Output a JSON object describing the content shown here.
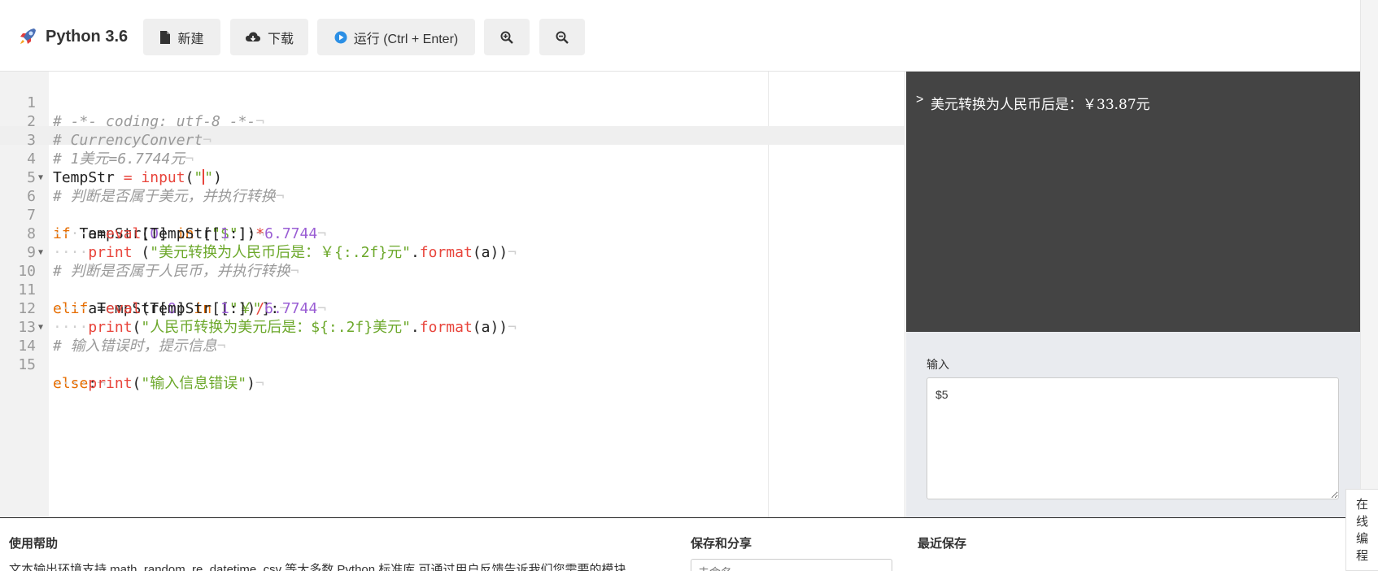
{
  "toolbar": {
    "title": "Python 3.6",
    "new_label": "新建",
    "download_label": "下载",
    "run_label": "运行 (Ctrl + Enter)"
  },
  "editor": {
    "lines": [
      {
        "n": "1",
        "code": "# -*- coding: utf-8 -*-"
      },
      {
        "n": "2",
        "code": "# CurrencyConvert"
      },
      {
        "n": "3",
        "code": "# 1美元=6.7744元"
      },
      {
        "n": "4",
        "code": "TempStr = input(\"\")"
      },
      {
        "n": "5",
        "code": "# 判断是否属于美元，并执行转换"
      },
      {
        "n": "6",
        "code": "if TempStr[0] in [\"$\"]:"
      },
      {
        "n": "7",
        "code": "    a=eval(TempStr[1:])*6.7744"
      },
      {
        "n": "8",
        "code": "    print (\"美元转换为人民币后是：￥{:.2f}元\".format(a))"
      },
      {
        "n": "9",
        "code": "# 判断是否属于人民币，并执行转换"
      },
      {
        "n": "10",
        "code": "elif TempStr[0] in [\"￥\"]:"
      },
      {
        "n": "11",
        "code": "    a=eval(TempStr[1:])/6.7744"
      },
      {
        "n": "12",
        "code": "    print(\"人民币转换为美元后是：${:.2f}美元\".format(a))"
      },
      {
        "n": "13",
        "code": "# 输入错误时，提示信息"
      },
      {
        "n": "14",
        "code": "else:"
      },
      {
        "n": "15",
        "code": "    print(\"输入信息错误\")"
      }
    ]
  },
  "output": {
    "prompt": ">",
    "text": "美元转换为人民币后是：￥33.87元"
  },
  "input_panel": {
    "label": "输入",
    "value": "$5"
  },
  "bottom": {
    "help_title": "使用帮助",
    "help_text": "文本输出环境支持 math, random, re, datetime, csv 等大多数 Python 标准库,可通过用户反馈告诉我们您需要的模块",
    "save_title": "保存和分享",
    "name_placeholder": "未命名",
    "recent_title": "最近保存"
  },
  "side_tab": {
    "chars": [
      "在",
      "线",
      "编",
      "程"
    ]
  },
  "colors": {
    "output_bg": "#444444",
    "input_bg": "#e9ebef",
    "keyword": "#e66d00",
    "function": "#e8453c",
    "string": "#6ca82b",
    "number": "#9a5ed4",
    "comment": "#9a9a9a",
    "run_icon": "#2b8fe5"
  }
}
